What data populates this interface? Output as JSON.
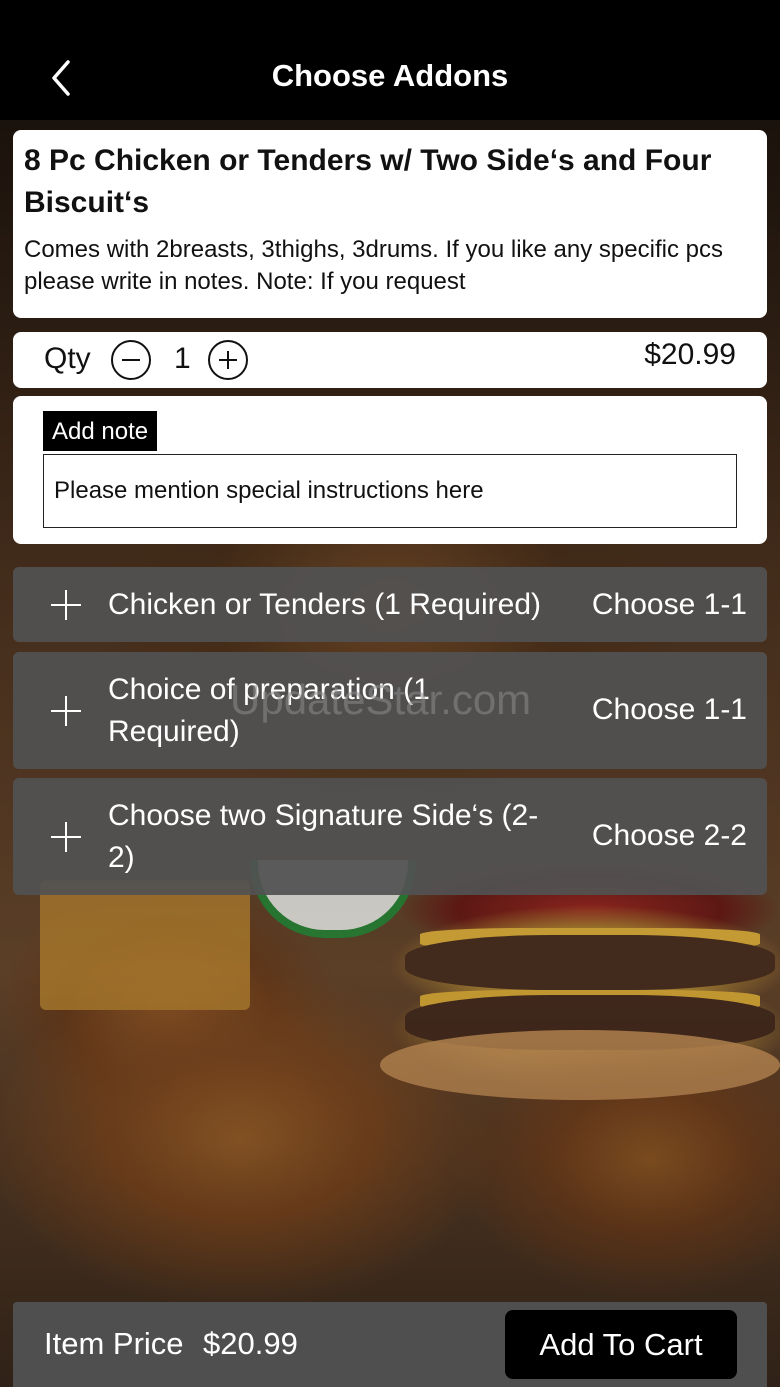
{
  "header": {
    "title": "Choose Addons",
    "back_icon": "chevron-left-icon"
  },
  "item": {
    "title": "8 Pc Chicken or Tenders w/ Two Side‘s and Four Biscuit‘s",
    "description": "Comes with 2breasts, 3thighs, 3drums. If you like any specific pcs please write in notes. Note: If you request"
  },
  "qty": {
    "label": "Qty",
    "value": "1",
    "price": "$20.99"
  },
  "note": {
    "label": "Add note",
    "placeholder": "Please mention special instructions here"
  },
  "addons": [
    {
      "label": "Chicken or Tenders (1 Required)",
      "choose": "Choose 1-1"
    },
    {
      "label": "Choice of preparation (1 Required)",
      "choose": "Choose 1-1"
    },
    {
      "label": "Choose two Signature Side‘s (2-2)",
      "choose": "Choose 2-2"
    }
  ],
  "watermark": "UpdateStar.com",
  "footer": {
    "item_price_label": "Item Price",
    "item_price_value": "$20.99",
    "add_to_cart": "Add To Cart"
  },
  "colors": {
    "header_bg": "#000000",
    "addon_bg": "#525252",
    "footer_bg": "#4f4f4f",
    "button_bg": "#000000"
  }
}
